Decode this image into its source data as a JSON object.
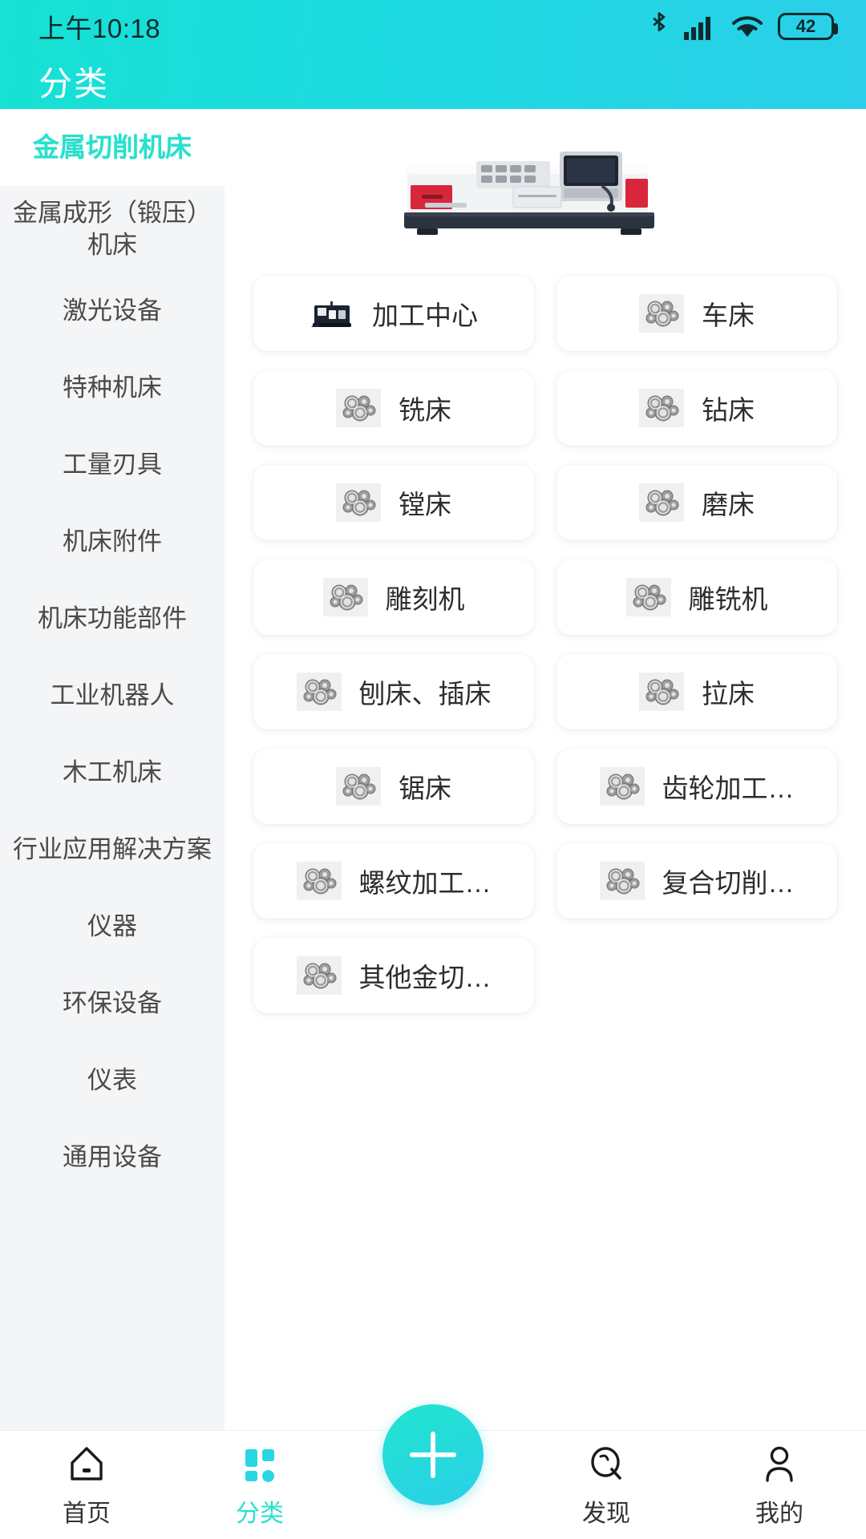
{
  "status_bar": {
    "time": "上午10:18",
    "battery_level": "42",
    "icons": [
      "bluetooth-icon",
      "cellular-signal-icon",
      "wifi-icon",
      "battery-icon"
    ]
  },
  "header": {
    "title": "分类"
  },
  "sidebar": {
    "items": [
      {
        "label": "金属切削机床",
        "active": true
      },
      {
        "label": "金属成形（锻压）机床",
        "active": false,
        "wrap": true
      },
      {
        "label": "激光设备",
        "active": false
      },
      {
        "label": "特种机床",
        "active": false
      },
      {
        "label": "工量刃具",
        "active": false
      },
      {
        "label": "机床附件",
        "active": false
      },
      {
        "label": "机床功能部件",
        "active": false
      },
      {
        "label": "工业机器人",
        "active": false
      },
      {
        "label": "木工机床",
        "active": false
      },
      {
        "label": "行业应用解决方案",
        "active": false
      },
      {
        "label": "仪器",
        "active": false
      },
      {
        "label": "环保设备",
        "active": false
      },
      {
        "label": "仪表",
        "active": false
      },
      {
        "label": "通用设备",
        "active": false
      }
    ]
  },
  "main": {
    "banner": {
      "icon": "cnc-lathe-machine-photo"
    },
    "cards": [
      {
        "label": "加工中心",
        "icon": "machining-center-photo-icon"
      },
      {
        "label": "车床",
        "icon": "gear-parts-icon"
      },
      {
        "label": "铣床",
        "icon": "gear-parts-icon"
      },
      {
        "label": "钻床",
        "icon": "gear-parts-icon"
      },
      {
        "label": "镗床",
        "icon": "gear-parts-icon"
      },
      {
        "label": "磨床",
        "icon": "gear-parts-icon"
      },
      {
        "label": "雕刻机",
        "icon": "gear-parts-icon"
      },
      {
        "label": "雕铣机",
        "icon": "gear-parts-icon"
      },
      {
        "label": "刨床、插床",
        "icon": "gear-parts-icon"
      },
      {
        "label": "拉床",
        "icon": "gear-parts-icon"
      },
      {
        "label": "锯床",
        "icon": "gear-parts-icon"
      },
      {
        "label": "齿轮加工…",
        "icon": "gear-parts-icon"
      },
      {
        "label": "螺纹加工…",
        "icon": "gear-parts-icon"
      },
      {
        "label": "复合切削…",
        "icon": "gear-parts-icon"
      },
      {
        "label": "其他金切…",
        "icon": "gear-parts-icon"
      }
    ]
  },
  "tabbar": {
    "items": [
      {
        "label": "首页",
        "icon": "home-icon",
        "active": false
      },
      {
        "label": "分类",
        "icon": "grid-categories-icon",
        "active": true
      },
      {
        "label": "发现",
        "icon": "discover-compass-icon",
        "active": false
      },
      {
        "label": "我的",
        "icon": "user-profile-icon",
        "active": false
      }
    ],
    "fab": {
      "icon": "plus-icon"
    }
  },
  "colors": {
    "accent": "#29e0cd",
    "header_gradient_start": "#16e1d3",
    "header_gradient_end": "#2bcfe9",
    "sidebar_bg": "#f4f5f7"
  }
}
